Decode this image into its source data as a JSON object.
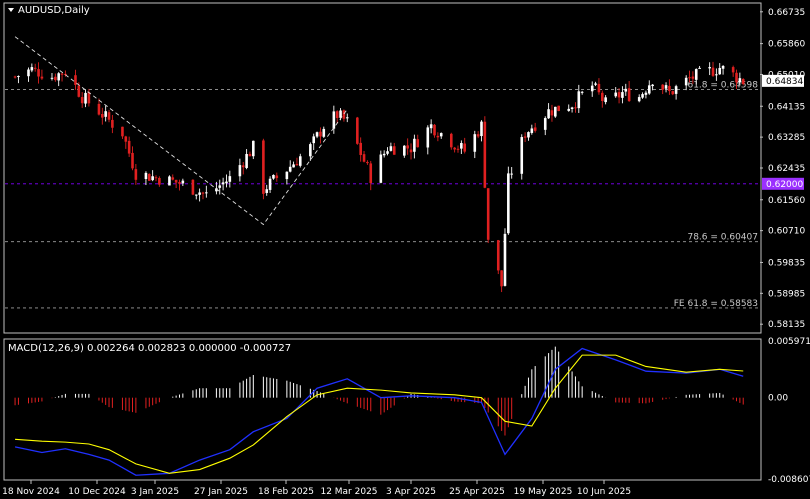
{
  "symbol_title": "AUDUSD,Daily",
  "macd_label": "MACD(12,26,9) 0.002264 0.002823 0.000000 -0.000727",
  "colors": {
    "background": "#000000",
    "frame": "#c0c0c0",
    "bull_candle": "#ffffff",
    "bear_candle": "#e02020",
    "macd_line": "#2030ff",
    "signal_line": "#ffff00",
    "level_line": "#a0a0a0",
    "support_line": "#8000ff",
    "price_tag": "#ffffff",
    "support_tag": "#9b30ff"
  },
  "chart_data": [
    {
      "type": "candlestick",
      "title": "AUDUSD,Daily",
      "x_labels": [
        "18 Nov 2024",
        "10 Dec 2024",
        "3 Jan 2025",
        "27 Jan 2025",
        "18 Feb 2025",
        "12 Mar 2025",
        "3 Apr 2025",
        "25 Apr 2025",
        "19 May 2025",
        "10 Jun 2025"
      ],
      "y_ticks": [
        "0.66735",
        "0.65860",
        "0.65010",
        "0.64135",
        "0.63285",
        "0.62435",
        "0.61560",
        "0.60710",
        "0.59835",
        "0.58985",
        "0.58135"
      ],
      "ylim": [
        0.5792,
        0.6695
      ],
      "last_price": "0.64834",
      "last_value": 0.64834,
      "levels": [
        {
          "label": "61.8 = 0.64598",
          "value": 0.64598
        },
        {
          "label": "78.6 = 0.60407",
          "value": 0.60407
        },
        {
          "label": "FE 61.8 = 0.58583",
          "value": 0.58583
        }
      ],
      "support": {
        "label": "0.62000",
        "value": 0.62
      },
      "fibo_trendline": [
        {
          "date": "2024-11-14",
          "value": 0.6605
        },
        {
          "date": "2025-01-27",
          "value": 0.6088
        },
        {
          "date": "2025-02-21",
          "value": 0.6405
        }
      ],
      "ohlc_path": [
        {
          "date": "2024-11-14",
          "close": 0.6495
        },
        {
          "date": "2024-11-19",
          "close": 0.6515
        },
        {
          "date": "2024-11-25",
          "close": 0.6495
        },
        {
          "date": "2024-11-29",
          "close": 0.651
        },
        {
          "date": "2024-12-04",
          "close": 0.644
        },
        {
          "date": "2024-12-09",
          "close": 0.64
        },
        {
          "date": "2024-12-16",
          "close": 0.634
        },
        {
          "date": "2024-12-20",
          "close": 0.623
        },
        {
          "date": "2024-12-27",
          "close": 0.6215
        },
        {
          "date": "2025-01-03",
          "close": 0.62
        },
        {
          "date": "2025-01-10",
          "close": 0.617
        },
        {
          "date": "2025-01-17",
          "close": 0.6215
        },
        {
          "date": "2025-01-24",
          "close": 0.63
        },
        {
          "date": "2025-01-27",
          "close": 0.6185
        },
        {
          "date": "2025-02-03",
          "close": 0.624
        },
        {
          "date": "2025-02-10",
          "close": 0.63
        },
        {
          "date": "2025-02-14",
          "close": 0.636
        },
        {
          "date": "2025-02-18",
          "close": 0.639
        },
        {
          "date": "2025-02-21",
          "close": 0.637
        },
        {
          "date": "2025-02-28",
          "close": 0.622
        },
        {
          "date": "2025-03-05",
          "close": 0.63
        },
        {
          "date": "2025-03-12",
          "close": 0.63
        },
        {
          "date": "2025-03-18",
          "close": 0.636
        },
        {
          "date": "2025-03-25",
          "close": 0.631
        },
        {
          "date": "2025-03-28",
          "close": 0.629
        },
        {
          "date": "2025-04-02",
          "close": 0.636
        },
        {
          "date": "2025-04-04",
          "close": 0.605
        },
        {
          "date": "2025-04-08",
          "close": 0.592
        },
        {
          "date": "2025-04-10",
          "close": 0.621
        },
        {
          "date": "2025-04-15",
          "close": 0.634
        },
        {
          "date": "2025-04-22",
          "close": 0.64
        },
        {
          "date": "2025-04-29",
          "close": 0.642
        },
        {
          "date": "2025-05-05",
          "close": 0.647
        },
        {
          "date": "2025-05-09",
          "close": 0.642
        },
        {
          "date": "2025-05-14",
          "close": 0.645
        },
        {
          "date": "2025-05-19",
          "close": 0.644
        },
        {
          "date": "2025-05-23",
          "close": 0.649
        },
        {
          "date": "2025-05-28",
          "close": 0.645
        },
        {
          "date": "2025-06-03",
          "close": 0.649
        },
        {
          "date": "2025-06-09",
          "close": 0.651
        },
        {
          "date": "2025-06-12",
          "close": 0.652
        },
        {
          "date": "2025-06-16",
          "close": 0.65
        },
        {
          "date": "2025-06-19",
          "close": 0.6483
        }
      ]
    },
    {
      "type": "macd",
      "title": "MACD(12,26,9) 0.002264 0.002823 0.000000 -0.000727",
      "y_ticks": [
        "0.005971",
        "0.00",
        "-0.008607"
      ],
      "ylim": [
        -0.0086,
        0.0061
      ],
      "macd_line": [
        {
          "date": "2024-11-14",
          "value": -0.0052
        },
        {
          "date": "2024-11-22",
          "value": -0.0058
        },
        {
          "date": "2024-11-29",
          "value": -0.0054
        },
        {
          "date": "2024-12-06",
          "value": -0.006
        },
        {
          "date": "2024-12-12",
          "value": -0.0066
        },
        {
          "date": "2024-12-20",
          "value": -0.0082
        },
        {
          "date": "2024-12-30",
          "value": -0.008
        },
        {
          "date": "2025-01-08",
          "value": -0.0066
        },
        {
          "date": "2025-01-17",
          "value": -0.0055
        },
        {
          "date": "2025-01-24",
          "value": -0.0036
        },
        {
          "date": "2025-02-03",
          "value": -0.0022
        },
        {
          "date": "2025-02-12",
          "value": 0.001
        },
        {
          "date": "2025-02-21",
          "value": 0.002
        },
        {
          "date": "2025-03-03",
          "value": 0.0
        },
        {
          "date": "2025-03-12",
          "value": 0.0002
        },
        {
          "date": "2025-03-25",
          "value": 0.0
        },
        {
          "date": "2025-04-02",
          "value": -0.0005
        },
        {
          "date": "2025-04-09",
          "value": -0.006
        },
        {
          "date": "2025-04-17",
          "value": -0.0022
        },
        {
          "date": "2025-04-24",
          "value": 0.003
        },
        {
          "date": "2025-05-02",
          "value": 0.0052
        },
        {
          "date": "2025-05-12",
          "value": 0.004
        },
        {
          "date": "2025-05-21",
          "value": 0.0028
        },
        {
          "date": "2025-06-02",
          "value": 0.0026
        },
        {
          "date": "2025-06-12",
          "value": 0.003
        },
        {
          "date": "2025-06-19",
          "value": 0.002264
        }
      ],
      "signal_line": [
        {
          "date": "2024-11-14",
          "value": -0.0044
        },
        {
          "date": "2024-11-22",
          "value": -0.0046
        },
        {
          "date": "2024-11-29",
          "value": -0.0047
        },
        {
          "date": "2024-12-06",
          "value": -0.0049
        },
        {
          "date": "2024-12-12",
          "value": -0.0055
        },
        {
          "date": "2024-12-20",
          "value": -0.007
        },
        {
          "date": "2024-12-30",
          "value": -0.008
        },
        {
          "date": "2025-01-08",
          "value": -0.0076
        },
        {
          "date": "2025-01-17",
          "value": -0.0064
        },
        {
          "date": "2025-01-24",
          "value": -0.005
        },
        {
          "date": "2025-02-03",
          "value": -0.002
        },
        {
          "date": "2025-02-12",
          "value": 0.0003
        },
        {
          "date": "2025-02-21",
          "value": 0.001
        },
        {
          "date": "2025-03-03",
          "value": 0.0008
        },
        {
          "date": "2025-03-12",
          "value": 0.0005
        },
        {
          "date": "2025-03-25",
          "value": 0.0003
        },
        {
          "date": "2025-04-02",
          "value": 0.0
        },
        {
          "date": "2025-04-09",
          "value": -0.0025
        },
        {
          "date": "2025-04-17",
          "value": -0.003
        },
        {
          "date": "2025-04-24",
          "value": 0.001
        },
        {
          "date": "2025-05-02",
          "value": 0.0045
        },
        {
          "date": "2025-05-12",
          "value": 0.0045
        },
        {
          "date": "2025-05-21",
          "value": 0.0033
        },
        {
          "date": "2025-06-02",
          "value": 0.0027
        },
        {
          "date": "2025-06-12",
          "value": 0.003
        },
        {
          "date": "2025-06-19",
          "value": 0.002823
        }
      ],
      "histogram": [
        {
          "date": "2024-11-14",
          "value": -0.0008
        },
        {
          "date": "2024-11-22",
          "value": -0.0004
        },
        {
          "date": "2024-11-29",
          "value": 0.0004
        },
        {
          "date": "2024-12-06",
          "value": 0.0004
        },
        {
          "date": "2024-12-12",
          "value": -0.001
        },
        {
          "date": "2024-12-20",
          "value": -0.0016
        },
        {
          "date": "2024-12-30",
          "value": 0.0
        },
        {
          "date": "2025-01-08",
          "value": 0.001
        },
        {
          "date": "2025-01-17",
          "value": 0.001
        },
        {
          "date": "2025-01-24",
          "value": 0.0024
        },
        {
          "date": "2025-02-03",
          "value": 0.0018
        },
        {
          "date": "2025-02-12",
          "value": 0.0007
        },
        {
          "date": "2025-02-21",
          "value": -0.0006
        },
        {
          "date": "2025-03-03",
          "value": -0.0018
        },
        {
          "date": "2025-03-12",
          "value": 0.0004
        },
        {
          "date": "2025-03-25",
          "value": -0.0004
        },
        {
          "date": "2025-04-02",
          "value": -0.0006
        },
        {
          "date": "2025-04-09",
          "value": -0.004
        },
        {
          "date": "2025-04-17",
          "value": 0.003
        },
        {
          "date": "2025-04-24",
          "value": 0.0054
        },
        {
          "date": "2025-05-02",
          "value": 0.0012
        },
        {
          "date": "2025-05-12",
          "value": -0.0005
        },
        {
          "date": "2025-05-21",
          "value": -0.0006
        },
        {
          "date": "2025-06-02",
          "value": 0.0003
        },
        {
          "date": "2025-06-12",
          "value": 0.0005
        },
        {
          "date": "2025-06-19",
          "value": -0.000727
        }
      ]
    }
  ]
}
